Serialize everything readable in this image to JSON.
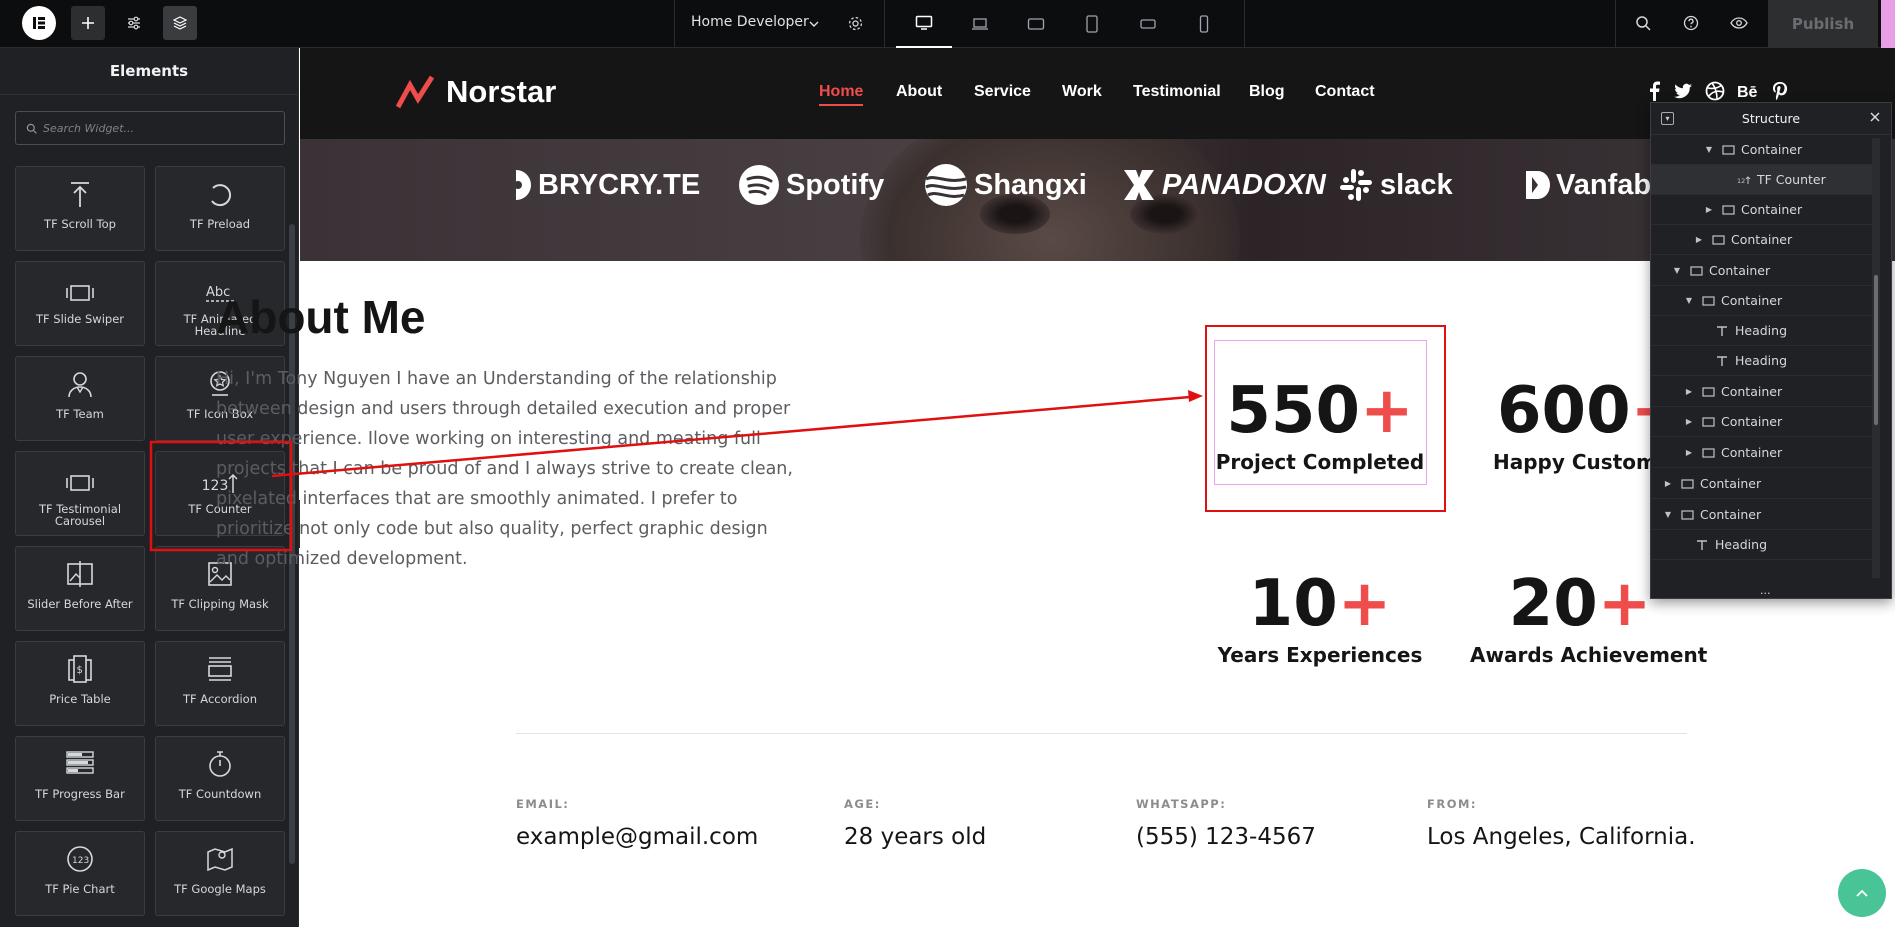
{
  "topbar": {
    "document_title": "Home Developer",
    "publish_label": "Publish"
  },
  "panel": {
    "title": "Elements",
    "search_placeholder": "Search Widget...",
    "widgets": [
      {
        "label": "TF Scroll Top",
        "icon": "scroll-top-icon"
      },
      {
        "label": "TF Preload",
        "icon": "preload-icon"
      },
      {
        "label": "TF Slide Swiper",
        "icon": "slide-swiper-icon"
      },
      {
        "label": "TF Animated Headline",
        "icon": "animated-headline-icon"
      },
      {
        "label": "TF Team",
        "icon": "team-icon"
      },
      {
        "label": "TF Icon Box",
        "icon": "icon-box-icon"
      },
      {
        "label": "TF Testimonial Carousel",
        "icon": "testimonial-carousel-icon"
      },
      {
        "label": "TF Counter",
        "icon": "counter-icon"
      },
      {
        "label": "Slider Before After",
        "icon": "slider-before-after-icon"
      },
      {
        "label": "TF Clipping Mask",
        "icon": "clipping-mask-icon"
      },
      {
        "label": "Price Table",
        "icon": "price-table-icon"
      },
      {
        "label": "TF Accordion",
        "icon": "accordion-icon"
      },
      {
        "label": "TF Progress Bar",
        "icon": "progress-bar-icon"
      },
      {
        "label": "TF Countdown",
        "icon": "countdown-icon"
      },
      {
        "label": "TF Pie Chart",
        "icon": "pie-chart-icon"
      },
      {
        "label": "TF Google Maps",
        "icon": "google-maps-icon"
      }
    ],
    "counter_icon_text": "123"
  },
  "site": {
    "logo": "Norstar",
    "nav": [
      "Home",
      "About",
      "Service",
      "Work",
      "Testimonial",
      "Blog",
      "Contact"
    ],
    "brands": [
      "BRYCRY.TE",
      "Spotify",
      "Shangxi",
      "PANADOXN",
      "slack",
      "Vanfaba"
    ],
    "about_title": "About Me",
    "about_text": "Hi, I'm Tony Nguyen I have an Understanding of the relationship between design and users through detailed execution and proper user experience. Ilove working on interesting and meating full projects that I can be proud of and I always strive to create clean, pixelated interfaces that are smoothly animated. I prefer to prioritize not only code but also quality, perfect graphic design and optimized development.",
    "stats": [
      {
        "number": "550",
        "plus": "+",
        "label": "Project Completed"
      },
      {
        "number": "600",
        "plus": "+",
        "label": "Happy Customer"
      },
      {
        "number": "10",
        "plus": "+",
        "label": "Years Experiences"
      },
      {
        "number": "20",
        "plus": "+",
        "label": "Awards Achievement"
      }
    ],
    "info": [
      {
        "key": "EMAIL:",
        "value": "example@gmail.com"
      },
      {
        "key": "AGE:",
        "value": "28 years old"
      },
      {
        "key": "WHATSAPP:",
        "value": "(555) 123-4567"
      },
      {
        "key": "FROM:",
        "value": "Los Angeles, California."
      }
    ]
  },
  "structure": {
    "title": "Structure",
    "rows": [
      {
        "label": "Container",
        "icon": "container-icon"
      },
      {
        "label": "TF Counter",
        "icon": "counter-icon",
        "selected": true
      },
      {
        "label": "Container",
        "icon": "container-icon"
      },
      {
        "label": "Container",
        "icon": "container-icon"
      },
      {
        "label": "Container",
        "icon": "container-icon"
      },
      {
        "label": "Container",
        "icon": "container-icon"
      },
      {
        "label": "Heading",
        "icon": "heading-icon"
      },
      {
        "label": "Heading",
        "icon": "heading-icon"
      },
      {
        "label": "Container",
        "icon": "container-icon"
      },
      {
        "label": "Container",
        "icon": "container-icon"
      },
      {
        "label": "Container",
        "icon": "container-icon"
      },
      {
        "label": "Container",
        "icon": "container-icon"
      },
      {
        "label": "Container",
        "icon": "container-icon"
      },
      {
        "label": "Heading",
        "icon": "heading-icon"
      }
    ],
    "more": "..."
  },
  "colors": {
    "accent_red": "#ef4c4c",
    "annotation_red": "#e01010",
    "editor_dark": "#1f2124",
    "fab_green": "#48c497"
  }
}
